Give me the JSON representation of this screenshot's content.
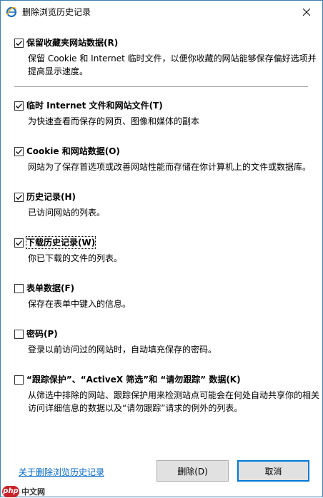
{
  "window": {
    "title": "删除浏览历史记录"
  },
  "options": [
    {
      "label": "保留收藏夹网站数据(R)",
      "checked": true,
      "description": "保留 Cookie 和 Internet 临时文件，以便你收藏的网站能够保存偏好选项并提高显示速度。"
    },
    {
      "label": "临时 Internet 文件和网站文件(T)",
      "checked": true,
      "description": "为快速查看而保存的网页、图像和媒体的副本"
    },
    {
      "label": "Cookie 和网站数据(O)",
      "checked": true,
      "description": "网站为了保存首选项或改善网站性能而存储在你计算机上的文件或数据库。"
    },
    {
      "label": "历史记录(H)",
      "checked": true,
      "description": "已访问网站的列表。"
    },
    {
      "label": "下载历史记录(W)",
      "checked": true,
      "description": "你已下载的文件的列表。"
    },
    {
      "label": "表单数据(F)",
      "checked": false,
      "description": "保存在表单中键入的信息。"
    },
    {
      "label": "密码(P)",
      "checked": false,
      "description": "登录以前访问过的网站时，自动填充保存的密码。"
    },
    {
      "label": "“跟踪保护”、“ActiveX 筛选”和 “请勿跟踪” 数据(K)",
      "checked": false,
      "description": "从筛选中排除的网站、跟踪保护用来检测站点可能会在何处自动共享你的相关访问详细信息的数据以及“请勿跟踪”请求的例外的列表。"
    }
  ],
  "footer": {
    "about_link": "关于删除浏览历史记录",
    "delete_label": "删除(D)",
    "cancel_label": "取消"
  },
  "watermark": {
    "logo": "php",
    "text": "中文网"
  },
  "colors": {
    "link": "#0066cc",
    "border": "#3c7fb1",
    "default_button_border": "#0078d7"
  }
}
